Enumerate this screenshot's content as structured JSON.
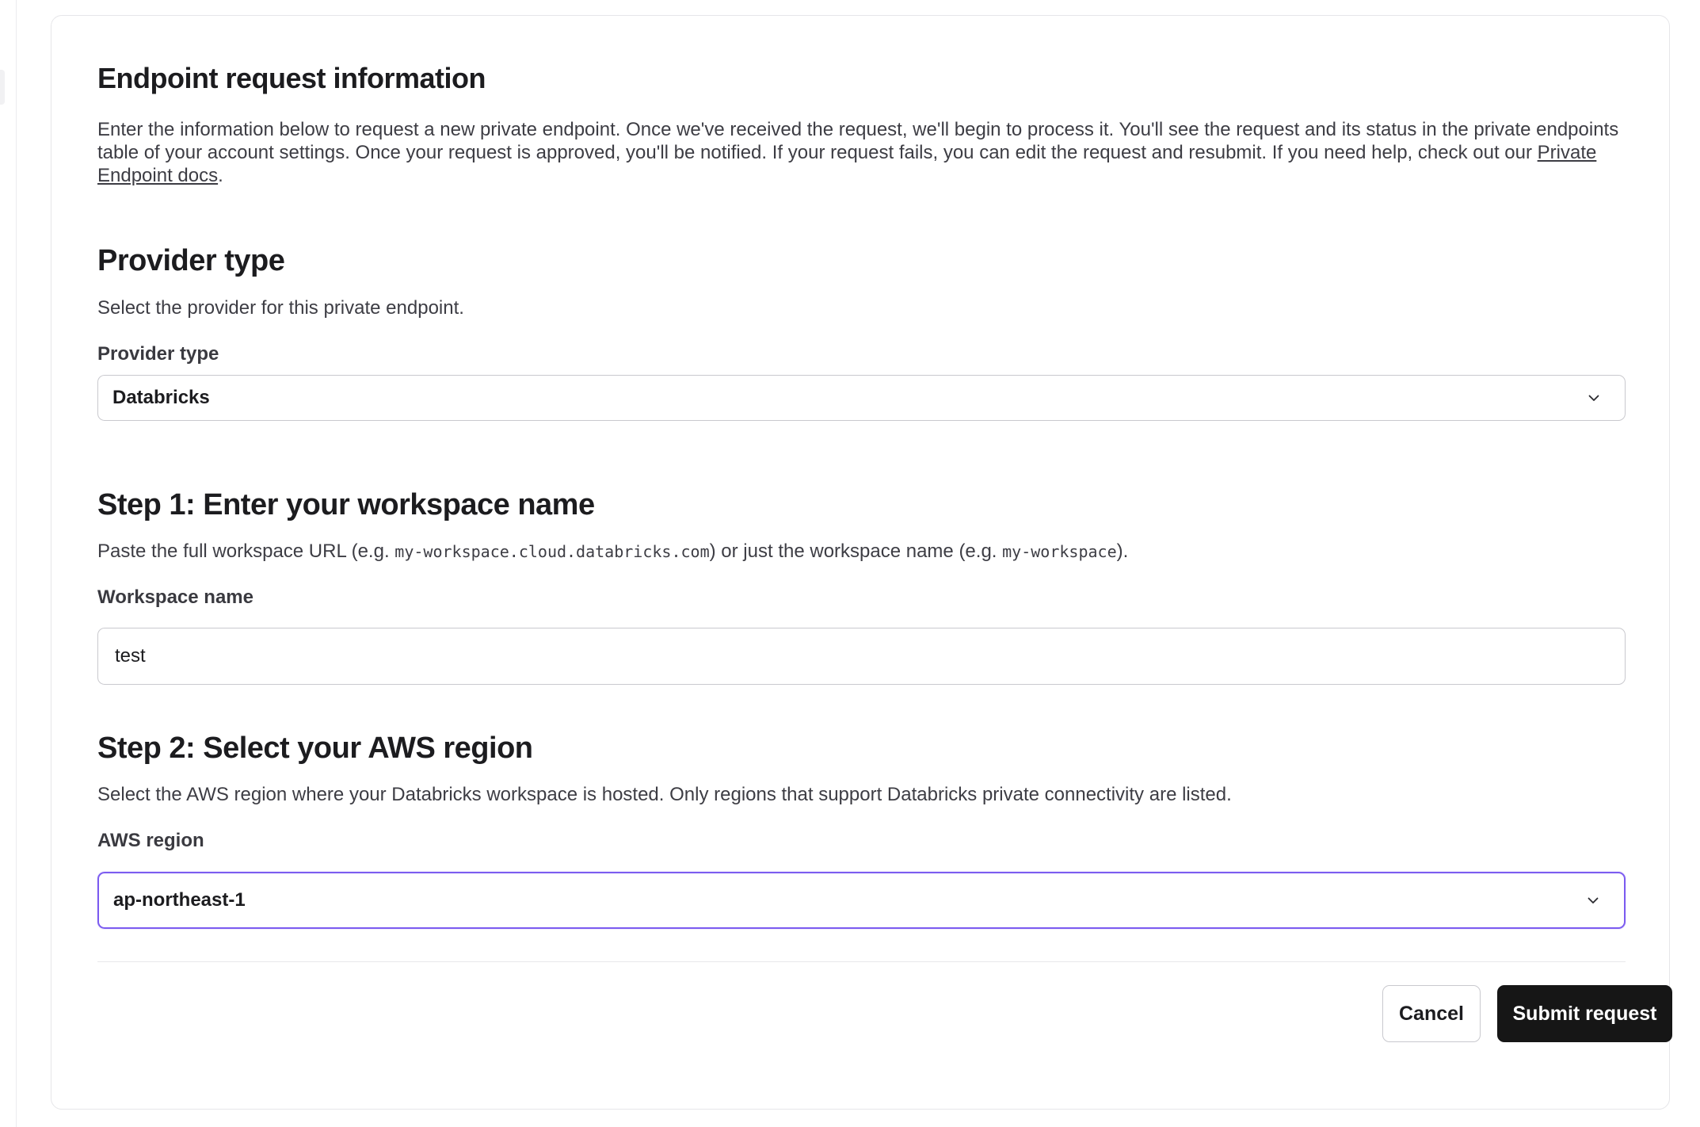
{
  "page": {
    "title": "Endpoint request information",
    "intro_text_before_link": "Enter the information below to request a new private endpoint. Once we've received the request, we'll begin to process it. You'll see the request and its status in the private endpoints table of your account settings. Once your request is approved, you'll be notified. If your request fails, you can edit the request and resubmit. If you need help, check out our ",
    "intro_link_text": "Private Endpoint docs",
    "intro_text_after_link": "."
  },
  "provider_section": {
    "heading": "Provider type",
    "description": "Select the provider for this private endpoint.",
    "field_label": "Provider type",
    "selected_value": "Databricks"
  },
  "workspace_section": {
    "heading": "Step 1: Enter your workspace name",
    "description_part1": "Paste the full workspace URL (e.g. ",
    "example_url": "my-workspace.cloud.databricks.com",
    "description_part2": ") or just the workspace name (e.g. ",
    "example_name": "my-workspace",
    "description_part3": ").",
    "field_label": "Workspace name",
    "field_value": "test"
  },
  "region_section": {
    "heading": "Step 2: Select your AWS region",
    "description": "Select the AWS region where your Databricks workspace is hosted. Only regions that support Databricks private connectivity are listed.",
    "field_label": "AWS region",
    "selected_value": "ap-northeast-1"
  },
  "actions": {
    "cancel_label": "Cancel",
    "submit_label": "Submit request"
  },
  "colors": {
    "focus_ring": "#7c5cf0",
    "primary_button": "#161616",
    "border": "#c9c9ce"
  },
  "icons": {
    "dropdown": "chevron-down-icon"
  }
}
